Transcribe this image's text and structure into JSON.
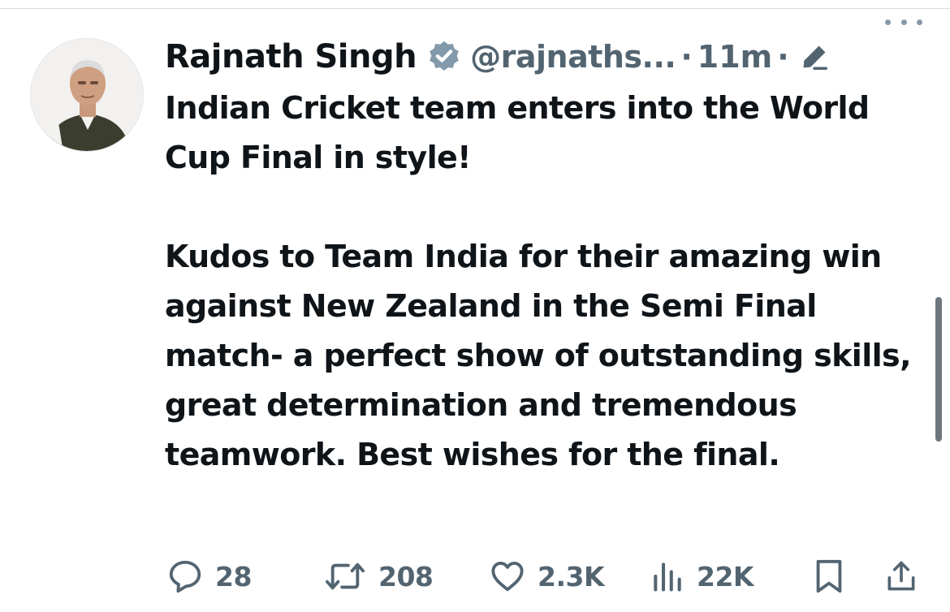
{
  "author": {
    "name": "Rajnath Singh",
    "handle": "@rajnaths...",
    "time": "11m",
    "separator": "·",
    "verified": true,
    "avatar": "profile-photo"
  },
  "tweet": {
    "paragraph1": "Indian Cricket team enters into the World Cup Final in style!",
    "paragraph2": "Kudos to Team India for their amazing win against New Zealand in the Semi Final match- a perfect show of outstanding skills, great determination and tremendous teamwork. Best wishes for the final."
  },
  "actions": {
    "replies": "28",
    "reposts": "208",
    "likes": "2.3K",
    "views": "22K"
  },
  "icons": {
    "verified": "verified-badge-icon",
    "edit": "edit-pencil-icon",
    "more": "more-options-icon",
    "reply": "reply-icon",
    "repost": "repost-icon",
    "like": "heart-icon",
    "views": "analytics-icon",
    "bookmark": "bookmark-icon",
    "share": "share-icon"
  },
  "colors": {
    "text": "#0f1419",
    "secondary": "#536471",
    "verified_badge": "#829aab"
  }
}
